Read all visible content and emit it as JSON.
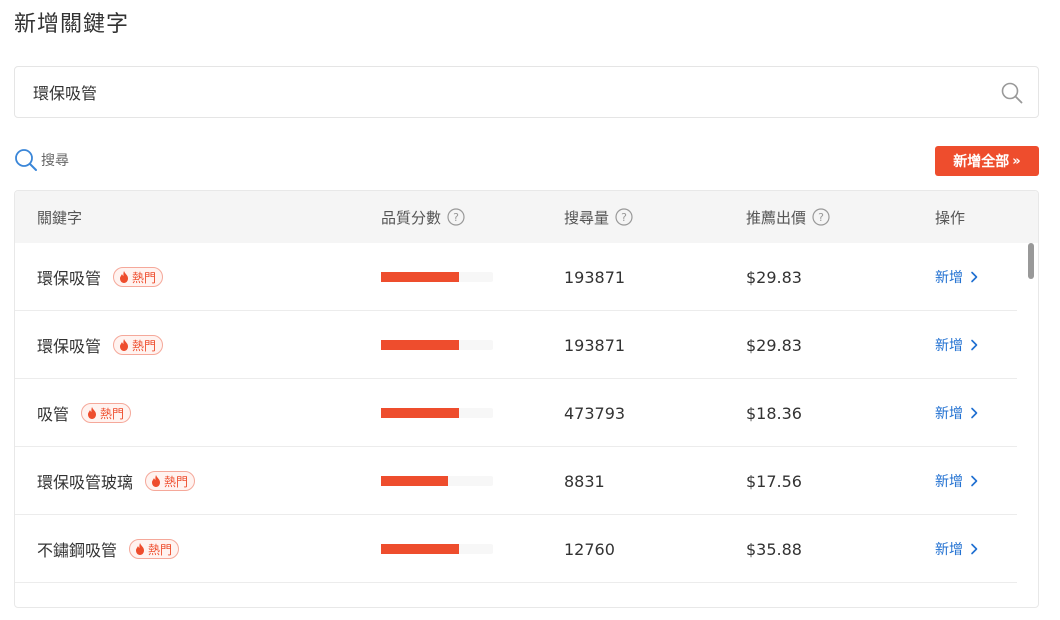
{
  "page": {
    "title": "新增關鍵字"
  },
  "search": {
    "value": "環保吸管",
    "icon": "search-icon"
  },
  "filter": {
    "label": "搜尋",
    "icon": "search-icon"
  },
  "add_all_button": {
    "label": "新增全部",
    "chevron": "»"
  },
  "colors": {
    "accent": "#ee4d2d",
    "link": "#1f6fd1"
  },
  "table": {
    "headers": {
      "keyword": "關鍵字",
      "quality": "品質分數",
      "search_volume": "搜尋量",
      "suggested_bid": "推薦出價",
      "action": "操作"
    },
    "hot_label": "熱門",
    "add_label": "新增",
    "rows": [
      {
        "keyword": "環保吸管",
        "hot": true,
        "quality": 0.7,
        "volume": "193871",
        "bid": "$29.83"
      },
      {
        "keyword": "環保吸管",
        "hot": true,
        "quality": 0.7,
        "volume": "193871",
        "bid": "$29.83"
      },
      {
        "keyword": "吸管",
        "hot": true,
        "quality": 0.7,
        "volume": "473793",
        "bid": "$18.36"
      },
      {
        "keyword": "環保吸管玻璃",
        "hot": true,
        "quality": 0.6,
        "volume": "8831",
        "bid": "$17.56"
      },
      {
        "keyword": "不鏽鋼吸管",
        "hot": true,
        "quality": 0.7,
        "volume": "12760",
        "bid": "$35.88"
      }
    ]
  }
}
